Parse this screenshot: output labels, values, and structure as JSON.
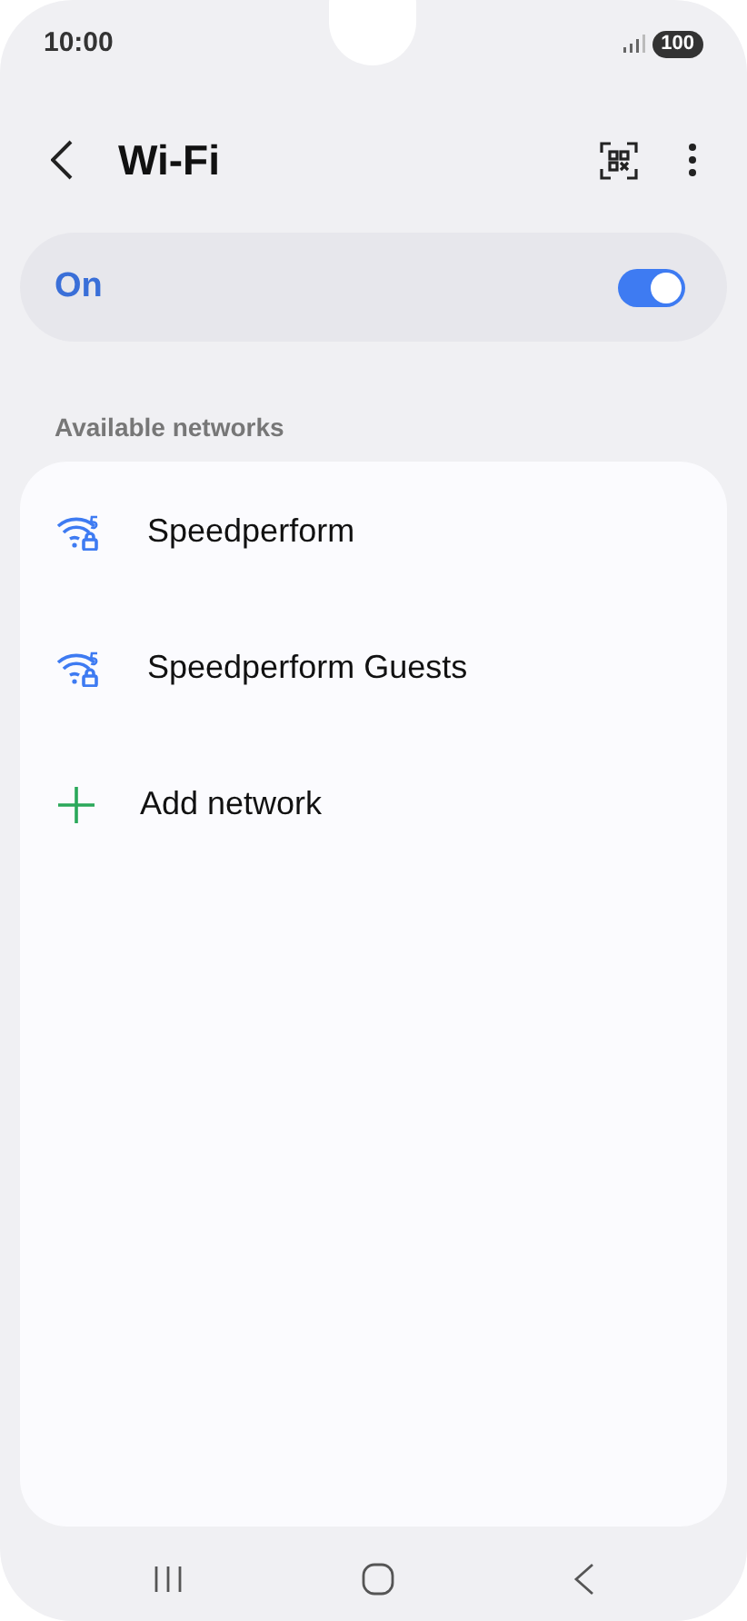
{
  "status_bar": {
    "time": "10:00",
    "battery": "100"
  },
  "header": {
    "title": "Wi-Fi"
  },
  "wifi_switch": {
    "label": "On",
    "on": true
  },
  "section_title": "Available networks",
  "networks": [
    {
      "kind": "wifi",
      "name": "Speedperform"
    },
    {
      "kind": "wifi",
      "name": "Speedperform Guests"
    },
    {
      "kind": "add",
      "name": "Add network"
    }
  ]
}
